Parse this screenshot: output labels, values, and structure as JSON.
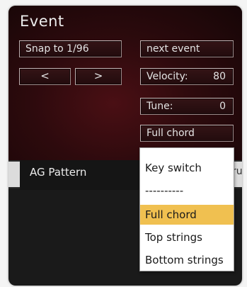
{
  "panel": {
    "title": "Event"
  },
  "controls": {
    "snap_label": "Snap to 1/96",
    "prev_arrow": "<",
    "next_arrow": ">",
    "next_event_label": "next event",
    "velocity_label": "Velocity:",
    "velocity_value": "80",
    "tune_label": "Tune:",
    "tune_value": "0",
    "mode_selected": "Full chord"
  },
  "tabs": [
    {
      "label": "AG Pattern"
    },
    {
      "label": "ru"
    }
  ],
  "dropdown": {
    "options": [
      {
        "label": "Key switch"
      },
      {
        "label": "----------"
      },
      {
        "label": "Full chord"
      },
      {
        "label": "Top strings"
      },
      {
        "label": "Bottom strings"
      }
    ],
    "selected_index": 2,
    "highlight_color": "#f0c050"
  }
}
